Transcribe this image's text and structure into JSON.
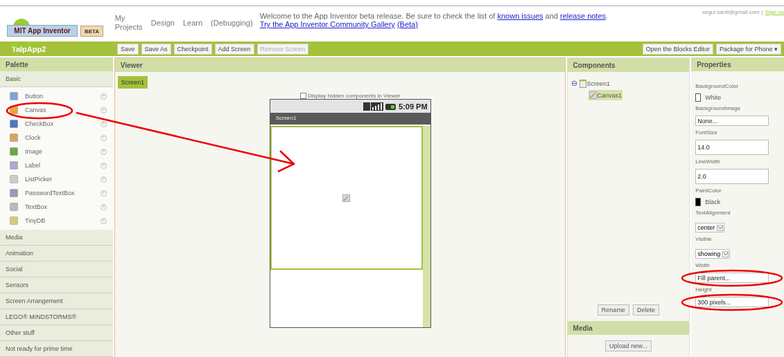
{
  "header": {
    "logo": "MIT App Inventor",
    "badge": "BETA",
    "nav": [
      "My Projects",
      "Design",
      "Learn",
      "(Debugging)"
    ],
    "welcome": {
      "text": "Welcome to the App Inventor beta release. Be sure to check the list of",
      "link1": "known issues",
      "and": "and",
      "link2": "release notes",
      "sep": ".",
      "link3": "Try the App Inventor Community Gallery",
      "link4": "(Beta)"
    },
    "user": "segui.santi@gmail.com",
    "divider": "|",
    "signout": "Sign ou"
  },
  "toolbar": {
    "project": "TalpApp2",
    "buttons": [
      {
        "label": "Save",
        "disabled": false
      },
      {
        "label": "Save As",
        "disabled": false
      },
      {
        "label": "Checkpoint",
        "disabled": false
      },
      {
        "label": "Add Screen",
        "disabled": false
      },
      {
        "label": "Remove Screen",
        "disabled": true
      }
    ],
    "right_buttons": [
      "Open the Blocks Editor",
      "Package for Phone"
    ],
    "menu_caret": "▾"
  },
  "palette": {
    "title": "Palette",
    "open_section": "Basic",
    "help": "?",
    "items": [
      "Button",
      "Canvas",
      "CheckBox",
      "Clock",
      "Image",
      "Label",
      "ListPicker",
      "PasswordTextBox",
      "TextBox",
      "TinyDB"
    ],
    "sections": [
      "Media",
      "Animation",
      "Social",
      "Sensors",
      "Screen Arrangement",
      "LEGO® MINDSTORMS®",
      "Other stuff",
      "Not ready for prime time"
    ]
  },
  "viewer": {
    "title": "Viewer",
    "screen_tab": "Screen1",
    "hidden_checkbox": {
      "label": "Display hidden components in Viewer",
      "checked": false
    },
    "phone": {
      "time": "5:09 PM",
      "title": "Screen1",
      "canvas_selected": true
    }
  },
  "components": {
    "title": "Components",
    "tree": [
      {
        "label": "Screen1",
        "expanded": true,
        "selected": false,
        "children": [
          {
            "label": "Canvas1",
            "selected": true
          }
        ]
      }
    ],
    "buttons": [
      "Rename",
      "Delete"
    ],
    "media_title": "Media",
    "upload": "Upload new..."
  },
  "properties": {
    "title": "Properties",
    "items": [
      {
        "label": "BackgroundColor",
        "kind": "color",
        "value": "White",
        "color": "#ffffff"
      },
      {
        "label": "BackgroundImage",
        "kind": "field",
        "value": "None...",
        "circled": false
      },
      {
        "label": "FontSize",
        "kind": "textbox",
        "value": "14.0"
      },
      {
        "label": "LineWidth",
        "kind": "textbox",
        "value": "2.0"
      },
      {
        "label": "PaintColor",
        "kind": "color",
        "value": "Black",
        "color": "#000000"
      },
      {
        "label": "TextAlignment",
        "kind": "select",
        "value": "center"
      },
      {
        "label": "Visible",
        "kind": "select",
        "value": "showing"
      },
      {
        "label": "Width",
        "kind": "field",
        "value": "Fill parent...",
        "circled": true
      },
      {
        "label": "Height",
        "kind": "field",
        "value": "300 pixels...",
        "circled": true
      }
    ]
  }
}
